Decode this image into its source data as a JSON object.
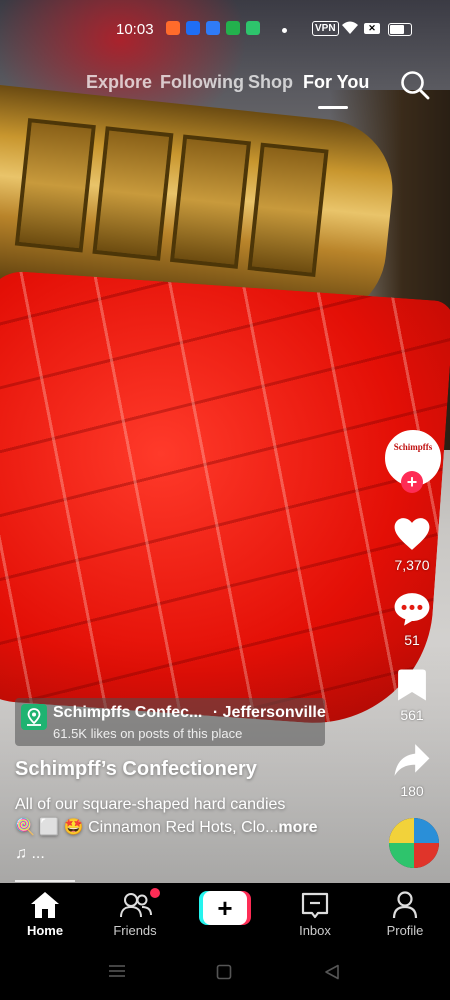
{
  "status_bar": {
    "time": "10:03",
    "vpn": "VPN",
    "app_icon_colors": [
      "#ff6b2b",
      "#1f6ef5",
      "#2f7bf7",
      "#23b14d",
      "#2ec46c"
    ]
  },
  "top_nav": {
    "tabs": [
      "Explore",
      "Following",
      "Shop",
      "For You"
    ],
    "active_tab": "For You"
  },
  "video": {
    "colors": {
      "candy": "#e8140b",
      "roller": "#c8962e"
    }
  },
  "rail": {
    "avatar_text": "Schimpffs",
    "likes": "7,370",
    "comments": "51",
    "saves": "561",
    "shares": "180"
  },
  "place": {
    "name": "Schimpffs Confec...",
    "city": "· Jeffersonville",
    "subtitle": "61.5K likes on posts of this place"
  },
  "post": {
    "title": "Schimpff’s Confectionery",
    "line1": "All of our square-shaped hard candies",
    "line2_emoji": "🍭 ⬜ 🤩",
    "line2_text": " Cinnamon Red Hots, Clo...",
    "more": "more",
    "music": "♫ ..."
  },
  "bottom_nav": {
    "items": [
      {
        "label": "Home",
        "active": true
      },
      {
        "label": "Friends",
        "badge": true
      },
      {
        "label": "",
        "create": true
      },
      {
        "label": "Inbox"
      },
      {
        "label": "Profile"
      }
    ],
    "accent": "#fe2c55",
    "accent2": "#25f4ee"
  }
}
